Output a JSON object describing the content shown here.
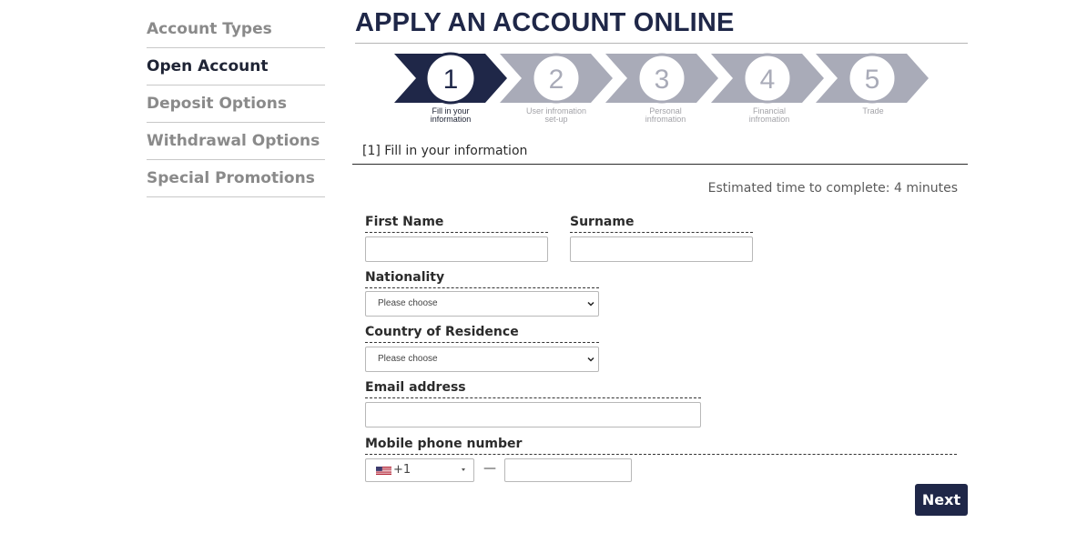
{
  "sidebar": {
    "items": [
      {
        "label": "Account Types"
      },
      {
        "label": "Open Account"
      },
      {
        "label": "Deposit Options"
      },
      {
        "label": "Withdrawal Options"
      },
      {
        "label": "Special Promotions"
      }
    ],
    "active_index": 1
  },
  "header": {
    "title": "APPLY AN ACCOUNT ONLINE"
  },
  "steps": {
    "current": 1,
    "items": [
      {
        "number": "1",
        "label_line1": "Fill in your",
        "label_line2": "information"
      },
      {
        "number": "2",
        "label_line1": "User infromation",
        "label_line2": "set-up"
      },
      {
        "number": "3",
        "label_line1": "Personal",
        "label_line2": "infromation"
      },
      {
        "number": "4",
        "label_line1": "Financial",
        "label_line2": "infromation"
      },
      {
        "number": "5",
        "label_line1": "Trade",
        "label_line2": ""
      }
    ],
    "colors": {
      "active": "#1f2748",
      "inactive": "#a9abb8"
    }
  },
  "section": {
    "title": "[1] Fill in your information"
  },
  "estimate": "Estimated time to complete: 4 minutes",
  "form": {
    "first_name": {
      "label": "First Name",
      "value": ""
    },
    "surname": {
      "label": "Surname",
      "value": ""
    },
    "nationality": {
      "label": "Nationality",
      "selected": "Please choose"
    },
    "residence": {
      "label": "Country of Residence",
      "selected": "Please choose"
    },
    "email": {
      "label": "Email address",
      "value": ""
    },
    "phone": {
      "label": "Mobile phone number",
      "country_code": "+1",
      "separator": "—",
      "value": ""
    }
  },
  "buttons": {
    "next_label": "Next"
  },
  "colors": {
    "brand": "#1f2748",
    "muted": "#8a8a8a"
  }
}
